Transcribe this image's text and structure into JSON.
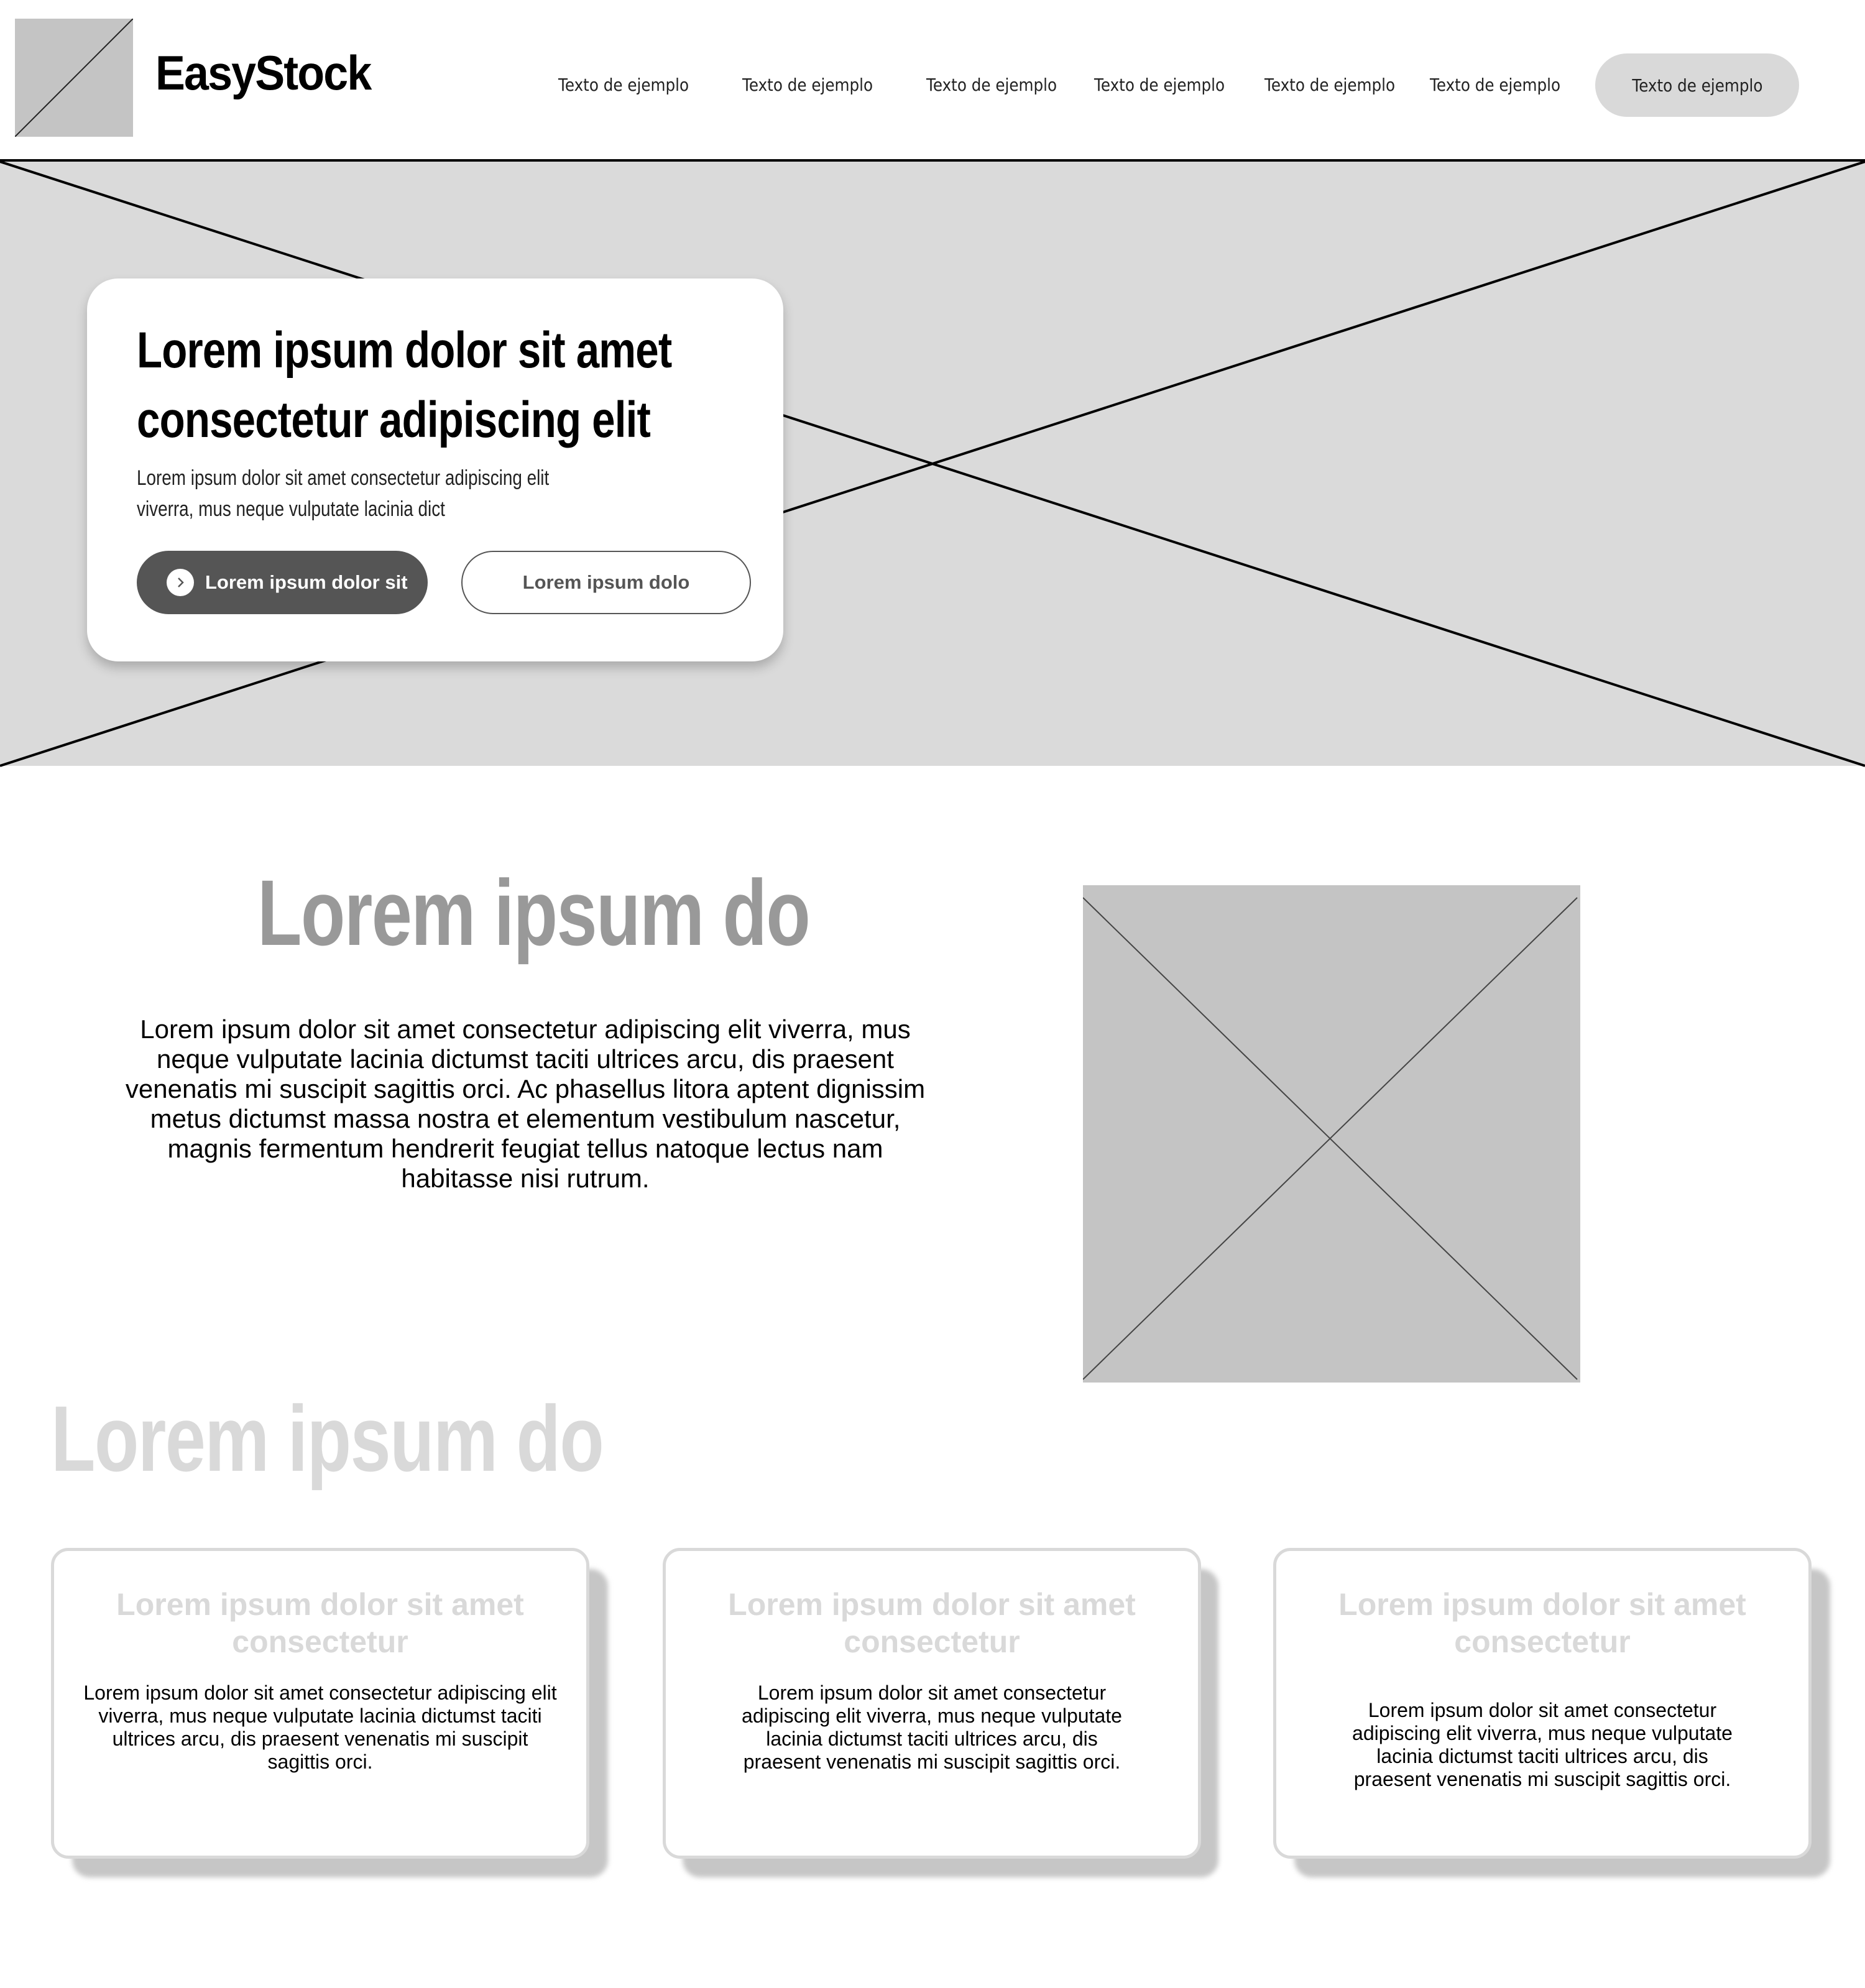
{
  "header": {
    "brand": "EasyStock",
    "nav": [
      "Texto de ejemplo",
      "Texto de ejemplo",
      "Texto de ejemplo",
      "Texto de ejemplo",
      "Texto de ejemplo",
      "Texto de ejemplo"
    ],
    "cta": "Texto de ejemplo"
  },
  "hero": {
    "title_line1": "Lorem ipsum dolor sit amet",
    "title_line2": "consectetur adipiscing elit",
    "subtitle_line1": "Lorem ipsum dolor sit amet consectetur adipiscing elit",
    "subtitle_line2": "viverra, mus neque vulputate lacinia dict",
    "primary_button": "Lorem ipsum dolor sit",
    "primary_button_icon": "chevron-right-icon",
    "secondary_button": "Lorem ipsum dolo"
  },
  "about": {
    "title": "Lorem ipsum do",
    "body": "Lorem ipsum dolor sit amet consectetur adipiscing elit viverra, mus neque vulputate lacinia dictumst taciti ultrices arcu, dis praesent venenatis mi suscipit sagittis orci. Ac phasellus litora aptent dignissim metus dictumst massa nostra et elementum vestibulum nascetur, magnis fermentum hendrerit feugiat tellus natoque lectus nam habitasse nisi rutrum."
  },
  "features": {
    "title": "Lorem ipsum do",
    "cards": [
      {
        "title": "Lorem ipsum dolor sit amet consectetur",
        "text": "Lorem ipsum dolor sit amet consectetur adipiscing elit viverra, mus neque vulputate lacinia dictumst taciti ultrices arcu, dis praesent venenatis mi suscipit sagittis orci."
      },
      {
        "title": "Lorem ipsum dolor sit amet consectetur",
        "text": "Lorem ipsum dolor sit amet consectetur adipiscing elit viverra, mus neque vulputate lacinia dictumst taciti ultrices arcu, dis praesent venenatis mi suscipit sagittis orci."
      },
      {
        "title": "Lorem ipsum dolor sit amet consectetur",
        "text": "Lorem ipsum dolor sit amet consectetur adipiscing elit viverra, mus neque vulputate lacinia dictumst taciti ultrices arcu, dis praesent venenatis mi suscipit sagittis orci."
      }
    ]
  },
  "colors": {
    "placeholder": "#c4c4c4",
    "hero_bg": "#dadada",
    "primary_button": "#555555",
    "about_title": "#999999",
    "features_title": "#d9d9d9"
  }
}
